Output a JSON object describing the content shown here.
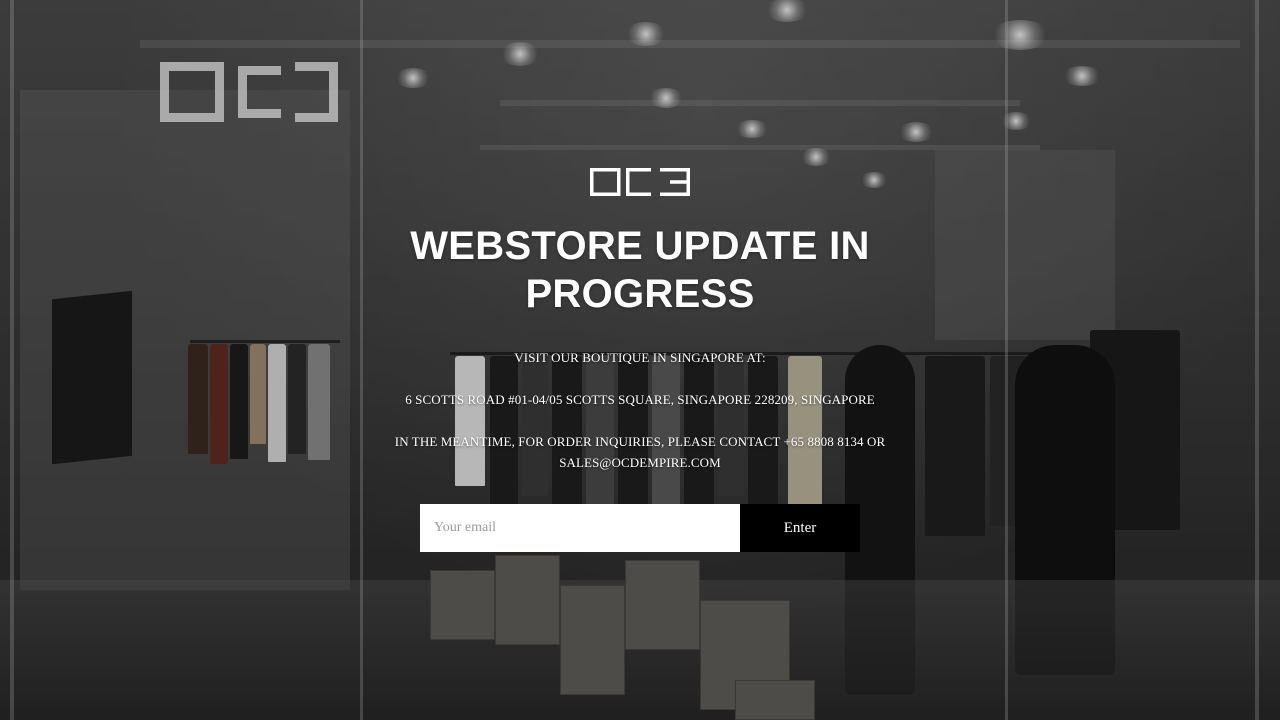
{
  "brand": {
    "logo_icon": "ocd-logo-icon",
    "logo_color": "#ffffff"
  },
  "headline": "WEBSTORE UPDATE IN PROGRESS",
  "info": {
    "visit": "VISIT OUR BOUTIQUE IN SINGAPORE AT:",
    "address": "6 SCOTTS ROAD #01-04/05 SCOTTS SQUARE, SINGAPORE 228209, SINGAPORE",
    "contact": "IN THE MEANTIME, FOR ORDER INQUIRIES, PLEASE CONTACT +65 8808 8134 OR SALES@OCDEMPIRE.COM"
  },
  "signup": {
    "email_placeholder": "Your email",
    "email_value": "",
    "submit_label": "Enter"
  },
  "colors": {
    "text": "#ffffff",
    "button_bg": "#000000",
    "input_bg": "#ffffff",
    "placeholder": "#9a9a9a"
  }
}
